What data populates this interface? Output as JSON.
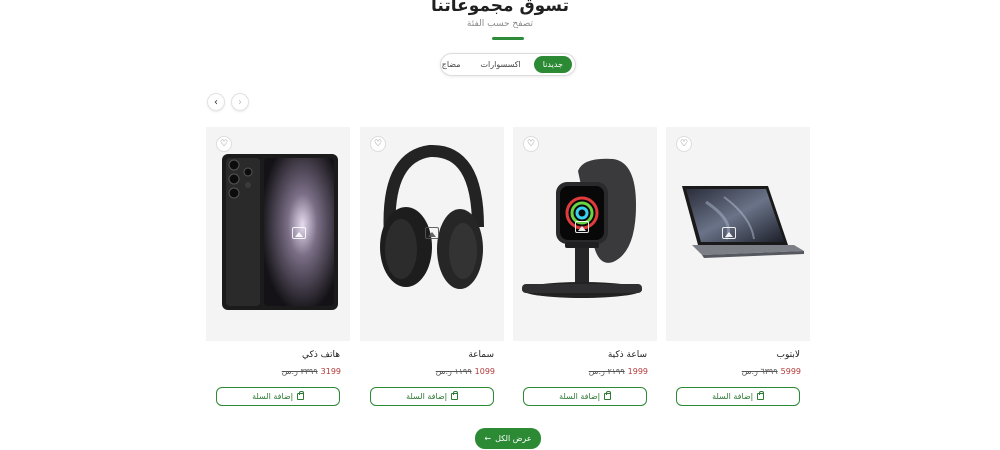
{
  "header": {
    "title": "تسوق مجموعاتنا",
    "subtitle": "تصفح حسب الفئة"
  },
  "tabs": [
    {
      "label": "جديدنا",
      "active": true
    },
    {
      "label": "اكسسوارات",
      "active": false
    },
    {
      "label": "مضاج",
      "active": false
    }
  ],
  "carousel": {
    "prev_icon": "chevron-left-icon",
    "next_icon": "chevron-right-icon"
  },
  "products": [
    {
      "name": "لابتوب",
      "price": "5999",
      "old_price": "٦٣٩٩ ر.س",
      "cart_label": "إضافة السلة"
    },
    {
      "name": "ساعة ذكية",
      "price": "1999",
      "old_price": "٢١٩٩ ر.س",
      "cart_label": "إضافة السلة"
    },
    {
      "name": "سماعة",
      "price": "1099",
      "old_price": "١١٩٩ ر.س",
      "cart_label": "إضافة السلة"
    },
    {
      "name": "هاتف ذكي",
      "price": "3199",
      "old_price": "٣٣٩٩ ر.س",
      "cart_label": "إضافة السلة"
    }
  ],
  "footer": {
    "view_all_label": "عرض الكل",
    "view_all_icon": "arrow-left-icon"
  },
  "colors": {
    "accent": "#2c8a35",
    "price": "#b23a3a"
  }
}
